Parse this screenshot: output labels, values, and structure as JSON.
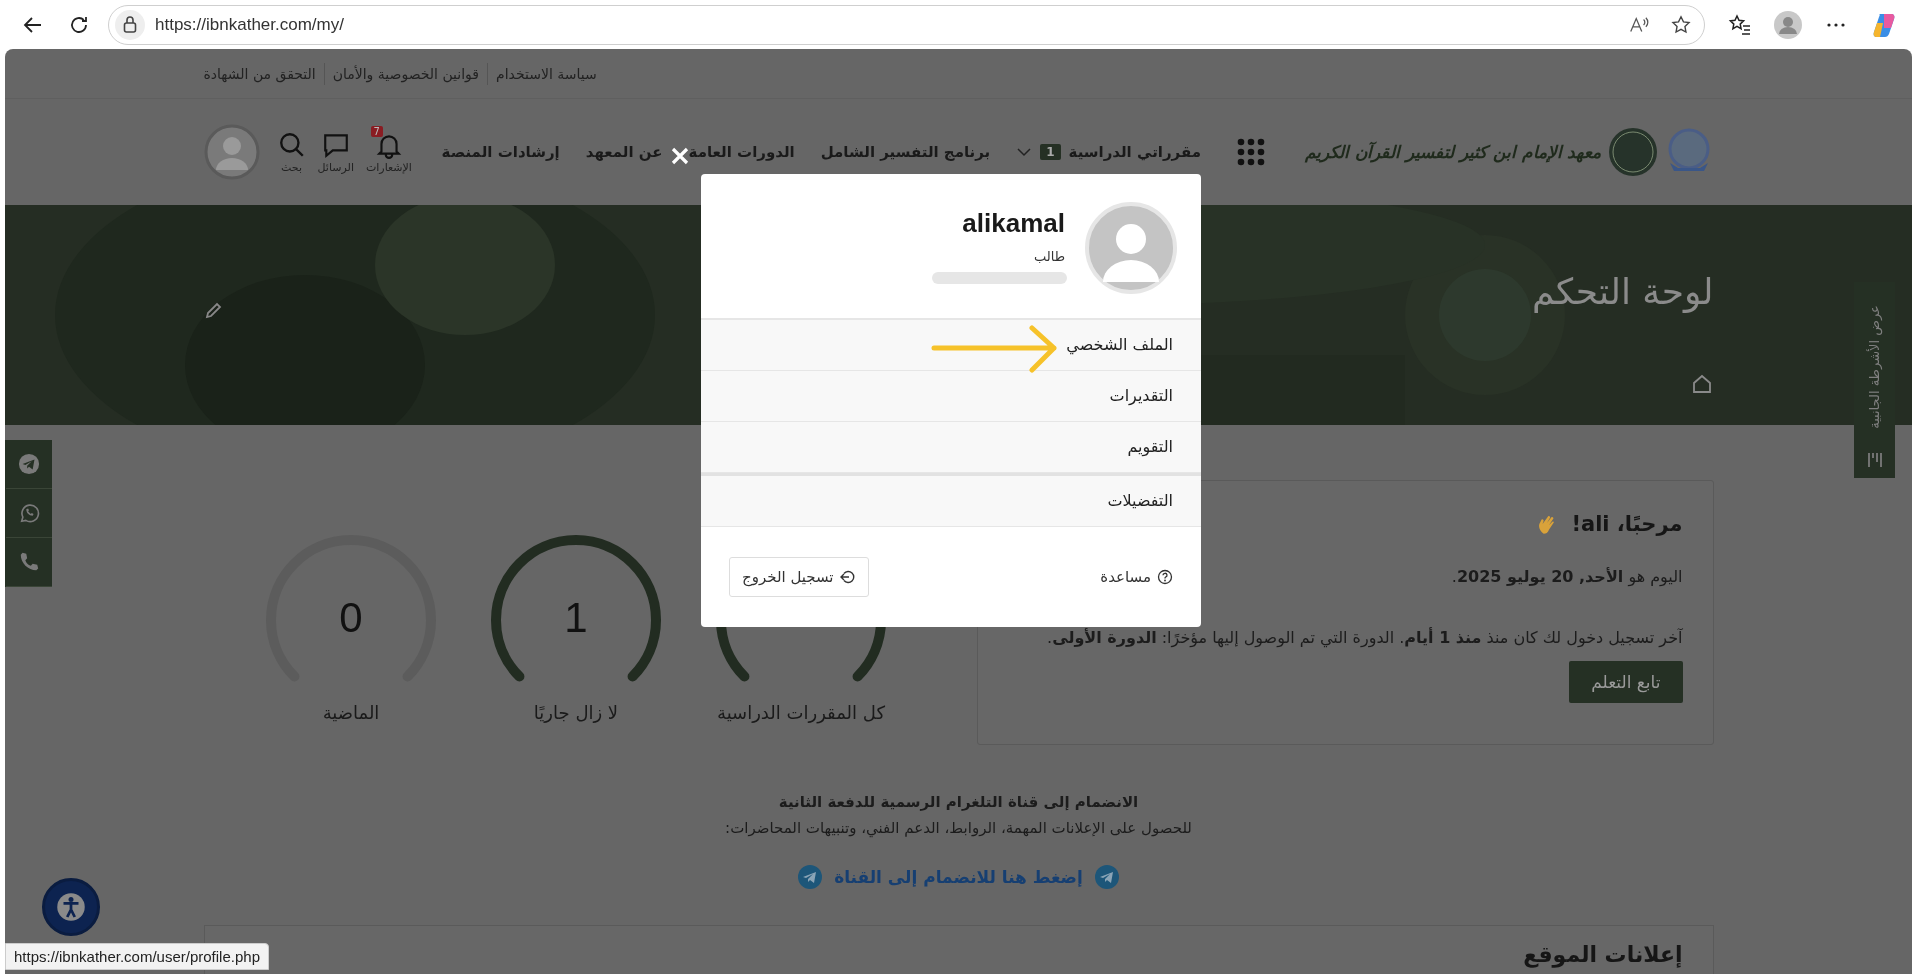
{
  "browser": {
    "url": "https://ibnkather.com/my/",
    "status_url": "https://ibnkather.com/user/profile.php"
  },
  "top_links": [
    "سياسة الاستخدام",
    "قوانين الخصوصية والأمان",
    "التحقق من الشهادة"
  ],
  "header": {
    "logo_text": "معهد الإمام ابن كثير لتفسير القرآن الكريم",
    "nav_items": [
      {
        "label": "مقرراتي الدراسية",
        "badge": "1",
        "dropdown": true
      },
      {
        "label": "برنامج التفسير الشامل",
        "dropdown": false
      },
      {
        "label": "الدورات العامة",
        "dropdown": false
      },
      {
        "label": "عن المعهد",
        "dropdown": false
      },
      {
        "label": "إرشادات المنصة",
        "dropdown": false
      }
    ],
    "icon_items": [
      {
        "kind": "bell",
        "label": "الإشعارات",
        "badge": "7"
      },
      {
        "kind": "chat",
        "label": "الرسائل"
      },
      {
        "kind": "search",
        "label": "بحث"
      }
    ]
  },
  "banner": {
    "title": "لوحة التحكم",
    "sidebar_toggle": "عرض الأشرطة الجانبية"
  },
  "welcome": {
    "title": "مرحبًا، ali!",
    "today": "اليوم هو **الأحد, 20 يوليو 2025**.",
    "last_login": "آخر تسجيل دخول لك كان منذ **منذ 1 أيام**. الدورة التي تم الوصول إليها مؤخرًا: **الدورة الأولى**.",
    "button": "تابع التعلم"
  },
  "stats": [
    {
      "label": "كل المقررات الدراسية",
      "active": true
    },
    {
      "value": "1",
      "label": "لا زال جاريًا",
      "active": true
    },
    {
      "value": "0",
      "label": "الماضية",
      "active": false
    }
  ],
  "telegram": {
    "title": "الانضمام إلى قناة التلغرام الرسمية للدفعة الثانية",
    "subtitle": "للحصول على الإعلانات المهمة، الروابط، الدعم الفني، وتنبيهات المحاضرات:",
    "link": "إضغط هنا للانضمام إلى القناة"
  },
  "announcements": {
    "title": "إعلانات الموقع"
  },
  "user_menu": {
    "username": "alikamal",
    "role": "طالب",
    "groups": [
      [
        {
          "label": "الملف الشخصي"
        },
        {
          "label": "التقديرات"
        },
        {
          "label": "التقويم"
        }
      ],
      [
        {
          "label": "التفضيلات"
        }
      ]
    ],
    "help": "مساعدة",
    "logout": "تسجيل الخروج"
  }
}
